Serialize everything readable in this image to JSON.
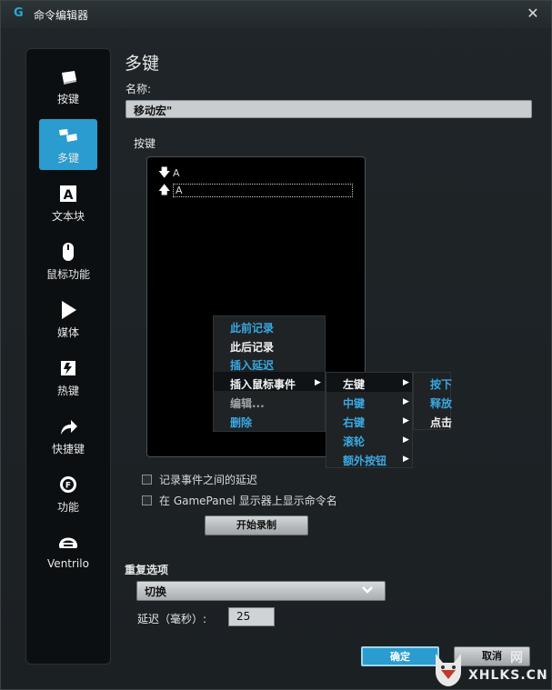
{
  "window": {
    "title": "命令编辑器",
    "close_icon": "✕"
  },
  "sidebar": {
    "items": [
      {
        "label": "按键",
        "icon": "keycap-icon",
        "active": false
      },
      {
        "label": "多键",
        "icon": "multi-keycap-icon",
        "active": true
      },
      {
        "label": "文本块",
        "icon": "text-block-icon",
        "active": false
      },
      {
        "label": "鼠标功能",
        "icon": "mouse-icon",
        "active": false
      },
      {
        "label": "媒体",
        "icon": "play-icon",
        "active": false
      },
      {
        "label": "热键",
        "icon": "hotkey-icon",
        "active": false
      },
      {
        "label": "快捷键",
        "icon": "shortcut-arrow-icon",
        "active": false
      },
      {
        "label": "功能",
        "icon": "function-gear-icon",
        "active": false
      },
      {
        "label": "Ventrilo",
        "icon": "headset-icon",
        "active": false
      }
    ]
  },
  "main": {
    "title": "多键",
    "name_label": "名称:",
    "name_value": "移动宏\"",
    "keys_label": "按键",
    "keys": [
      {
        "direction": "down",
        "key": "A"
      },
      {
        "direction": "up",
        "key": "A"
      }
    ]
  },
  "context_menu": {
    "items": [
      {
        "label": "此前记录",
        "style": "blue"
      },
      {
        "label": "此后记录",
        "style": "white"
      },
      {
        "label": "插入延迟",
        "style": "blue"
      },
      {
        "label": "插入鼠标事件",
        "style": "white",
        "submenu": true
      },
      {
        "label": "编辑...",
        "style": "dim"
      },
      {
        "label": "删除",
        "style": "blue"
      }
    ],
    "mouse_submenu": [
      {
        "label": "左键",
        "style": "white"
      },
      {
        "label": "中键",
        "style": "blue"
      },
      {
        "label": "右键",
        "style": "blue"
      },
      {
        "label": "滚轮",
        "style": "blue"
      },
      {
        "label": "额外按钮",
        "style": "blue"
      }
    ],
    "action_submenu": [
      {
        "label": "按下",
        "style": "blue"
      },
      {
        "label": "释放",
        "style": "blue"
      },
      {
        "label": "点击",
        "style": "white"
      }
    ]
  },
  "options": {
    "record_delays_label": "记录事件之间的延迟",
    "show_name_label": "在 GamePanel 显示器上显示命令名",
    "start_record_label": "开始录制"
  },
  "repeat": {
    "label": "重复选项",
    "selected": "切换",
    "delay_label": "延迟（毫秒）:",
    "delay_value": "25"
  },
  "footer": {
    "ok_label": "确定",
    "cancel_label": "取消"
  },
  "watermark": {
    "text": "XHLKS.CN",
    "cn": "网"
  },
  "colors": {
    "accent": "#2a9ccf",
    "menu_blue": "#3aa8e2"
  }
}
